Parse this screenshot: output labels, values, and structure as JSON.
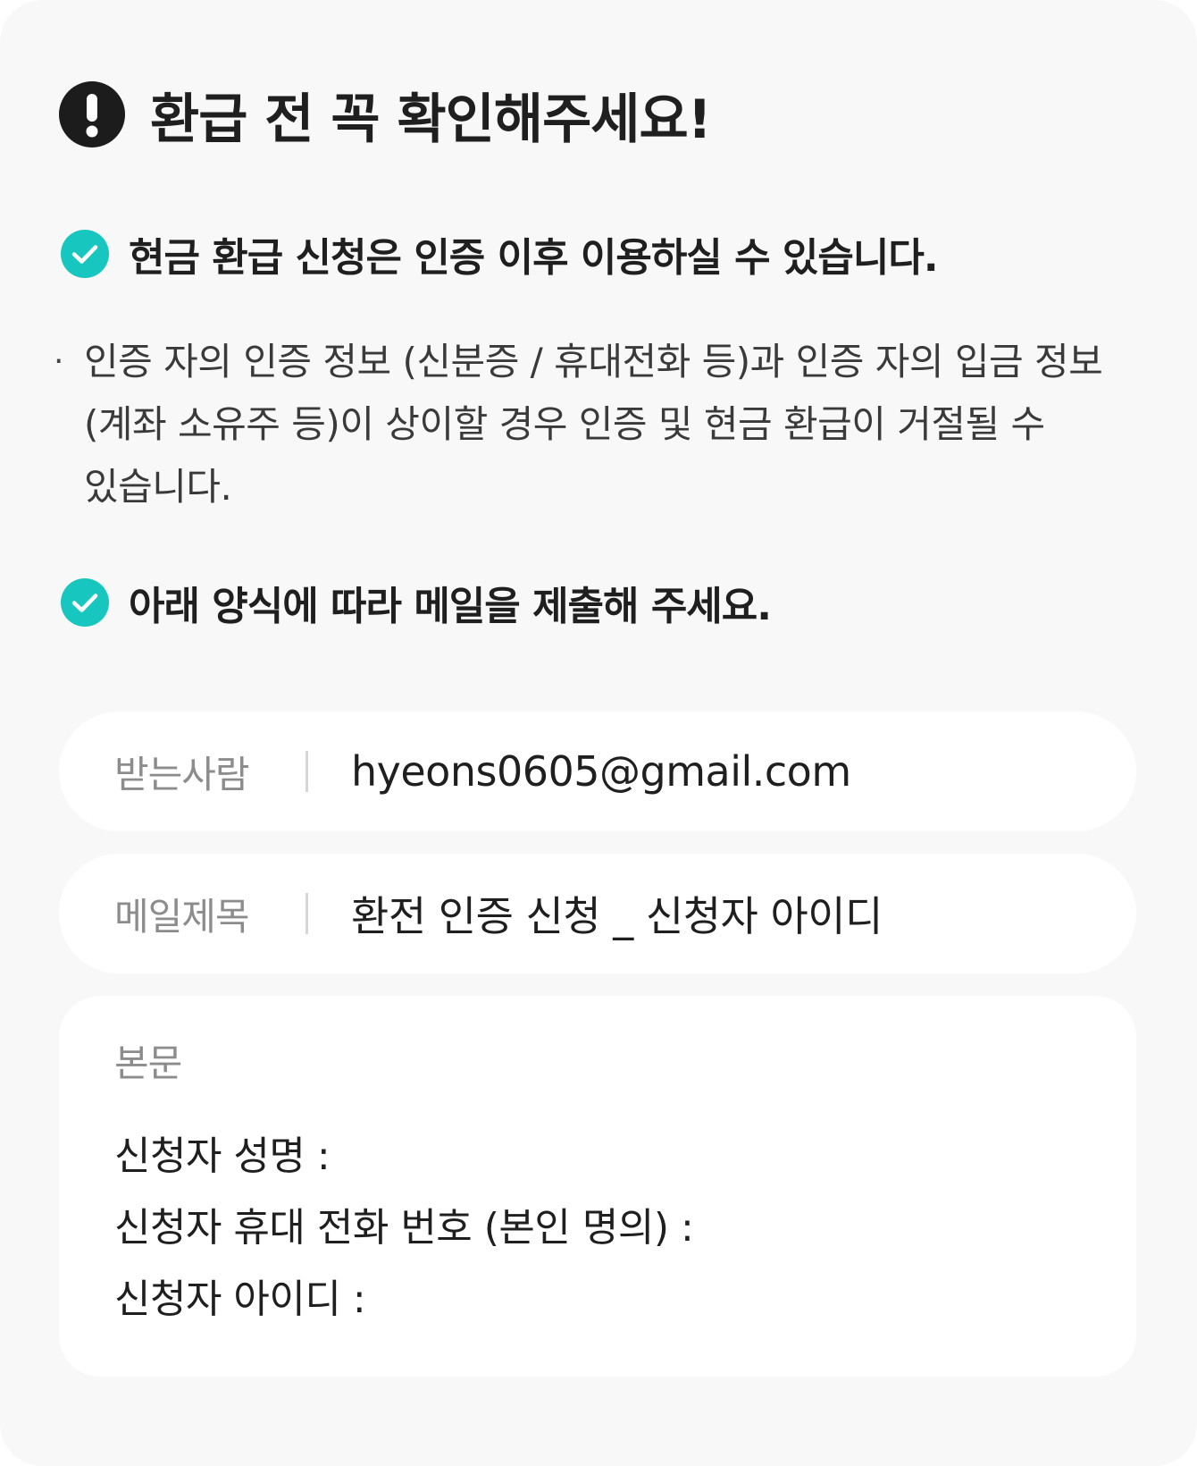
{
  "header": {
    "title": "환급 전 꼭 확인해주세요!",
    "icon": "exclamation-circle-icon"
  },
  "sections": [
    {
      "icon": "check-circle-icon",
      "title": "현금 환급 신청은 인증 이후 이용하실 수 있습니다."
    },
    {
      "icon": "check-circle-icon",
      "title": "아래 양식에 따라 메일을 제출해 주세요."
    }
  ],
  "note": {
    "bullet": "·",
    "text": "인증 자의 인증 정보 (신분증 / 휴대전화 등)과 인증 자의 입금 정보 (계좌 소유주 등)이 상이할 경우 인증 및 현금 환급이 거절될 수 있습니다."
  },
  "form": {
    "recipient": {
      "label": "받는사람",
      "value": "hyeons0605@gmail.com"
    },
    "subject": {
      "label": "메일제목",
      "value": "환전 인증 신청 _ 신청자 아이디"
    },
    "body": {
      "label": "본문",
      "lines": [
        "신청자 성명 :",
        "신청자 휴대 전화 번호 (본인 명의) :",
        "신청자 아이디 :"
      ]
    }
  },
  "colors": {
    "accent": "#17c7bf",
    "background": "#f8f8f8",
    "field_background": "#ffffff",
    "label_gray": "#8c8c8c",
    "text_dark": "#1f1f1f"
  }
}
